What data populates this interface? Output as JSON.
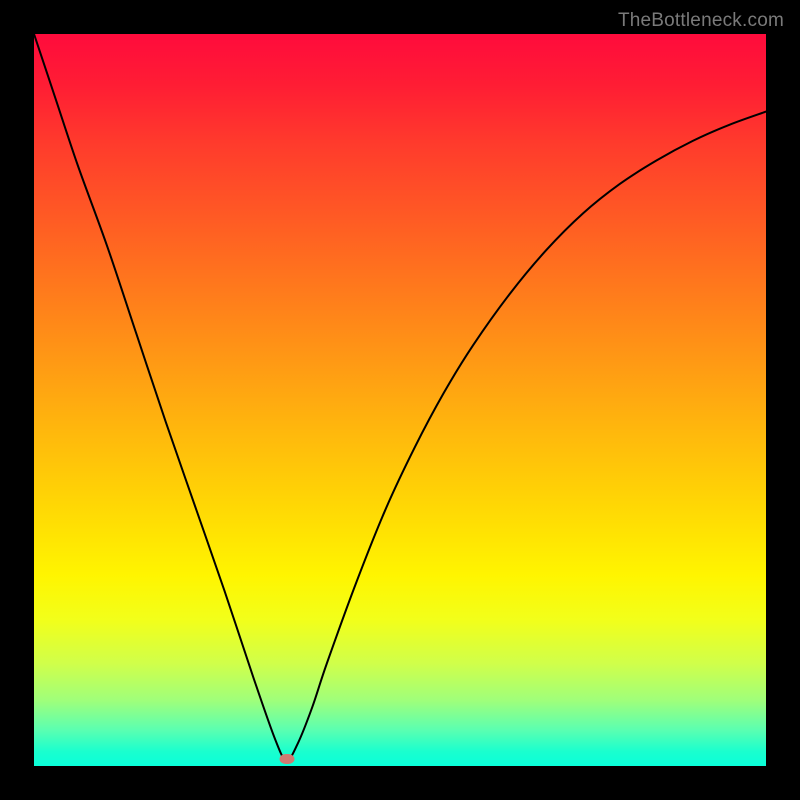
{
  "watermark": "TheBottleneck.com",
  "colors": {
    "page_bg": "#000000",
    "gradient_top": "#ff0b3c",
    "gradient_bottom": "#0affda",
    "curve": "#000000",
    "marker": "#cf7b72",
    "watermark_text": "#7a7a7a"
  },
  "chart_data": {
    "type": "line",
    "title": "",
    "xlabel": "",
    "ylabel": "",
    "xlim": [
      0,
      100
    ],
    "ylim": [
      0,
      100
    ],
    "grid": false,
    "legend": false,
    "background_gradient": "vertical red-to-green",
    "annotations": [
      {
        "kind": "marker",
        "shape": "ellipse",
        "x": 34.5,
        "y": 1.0
      }
    ],
    "series": [
      {
        "name": "curve",
        "color": "#000000",
        "x": [
          0,
          3,
          6,
          10,
          14,
          18,
          22,
          26,
          30,
          33,
          34.5,
          36,
          38,
          40,
          44,
          48,
          52,
          56,
          60,
          65,
          70,
          75,
          80,
          85,
          90,
          95,
          100
        ],
        "y": [
          100,
          91,
          82,
          71,
          59,
          47,
          35.5,
          24,
          12,
          3.5,
          0.8,
          3,
          8,
          14,
          25,
          35,
          43.5,
          51,
          57.5,
          64.5,
          70.5,
          75.5,
          79.5,
          82.7,
          85.4,
          87.6,
          89.4
        ]
      }
    ]
  }
}
